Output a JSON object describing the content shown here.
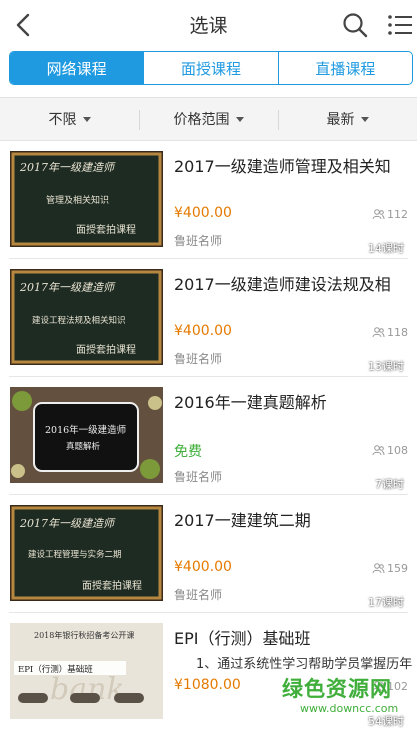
{
  "header": {
    "title": "选课",
    "back_icon": "back-arrow-icon",
    "search_icon": "search-icon",
    "menu_icon": "list-menu-icon"
  },
  "tabs": [
    {
      "label": "网络课程",
      "active": true
    },
    {
      "label": "面授课程",
      "active": false
    },
    {
      "label": "直播课程",
      "active": false
    }
  ],
  "filters": [
    {
      "label": "不限"
    },
    {
      "label": "价格范围"
    },
    {
      "label": "最新"
    }
  ],
  "courses": [
    {
      "title": "2017一级建造师管理及相关知",
      "price": "¥400.00",
      "teacher": "鲁班名师",
      "students": "112",
      "lessons": "14课时",
      "thumb": {
        "line1": "2017年一级建造师",
        "line2": "管理及相关知识",
        "line3": "面授套拍课程"
      }
    },
    {
      "title": "2017一级建造师建设法规及相",
      "price": "¥400.00",
      "teacher": "鲁班名师",
      "students": "118",
      "lessons": "13课时",
      "thumb": {
        "line1": "2017年一级建造师",
        "line2": "建设工程法规及相关知识",
        "line3": "面授套拍课程"
      }
    },
    {
      "title": "2016年一建真题解析",
      "price": "免费",
      "teacher": "鲁班名师",
      "students": "108",
      "lessons": "7课时",
      "thumb": {
        "line1": "2016年一级建造师",
        "line2": "真题解析",
        "line3": ""
      }
    },
    {
      "title": "2017一建建筑二期",
      "price": "¥400.00",
      "teacher": "鲁班名师",
      "students": "159",
      "lessons": "17课时",
      "thumb": {
        "line1": "2017年一级建造师",
        "line2": "建设工程管理与实务二期",
        "line3": "面授套拍课程"
      }
    },
    {
      "title": "EPI（行测）基础班",
      "price": "¥1080.00",
      "teacher": "",
      "students": "102",
      "lessons": "54课时",
      "description": "1、通过系统性学习帮助学员掌握历年",
      "thumb": {
        "line1": "2018年银行秋招备考公开课",
        "line2": "EPI（行测）基础班",
        "line3": ""
      }
    }
  ],
  "watermark": {
    "text": "绿色资源网",
    "url": "www.downcc.com"
  },
  "colors": {
    "accent": "#1f9ae0",
    "price": "#e57a00",
    "free": "#3fae3a"
  }
}
